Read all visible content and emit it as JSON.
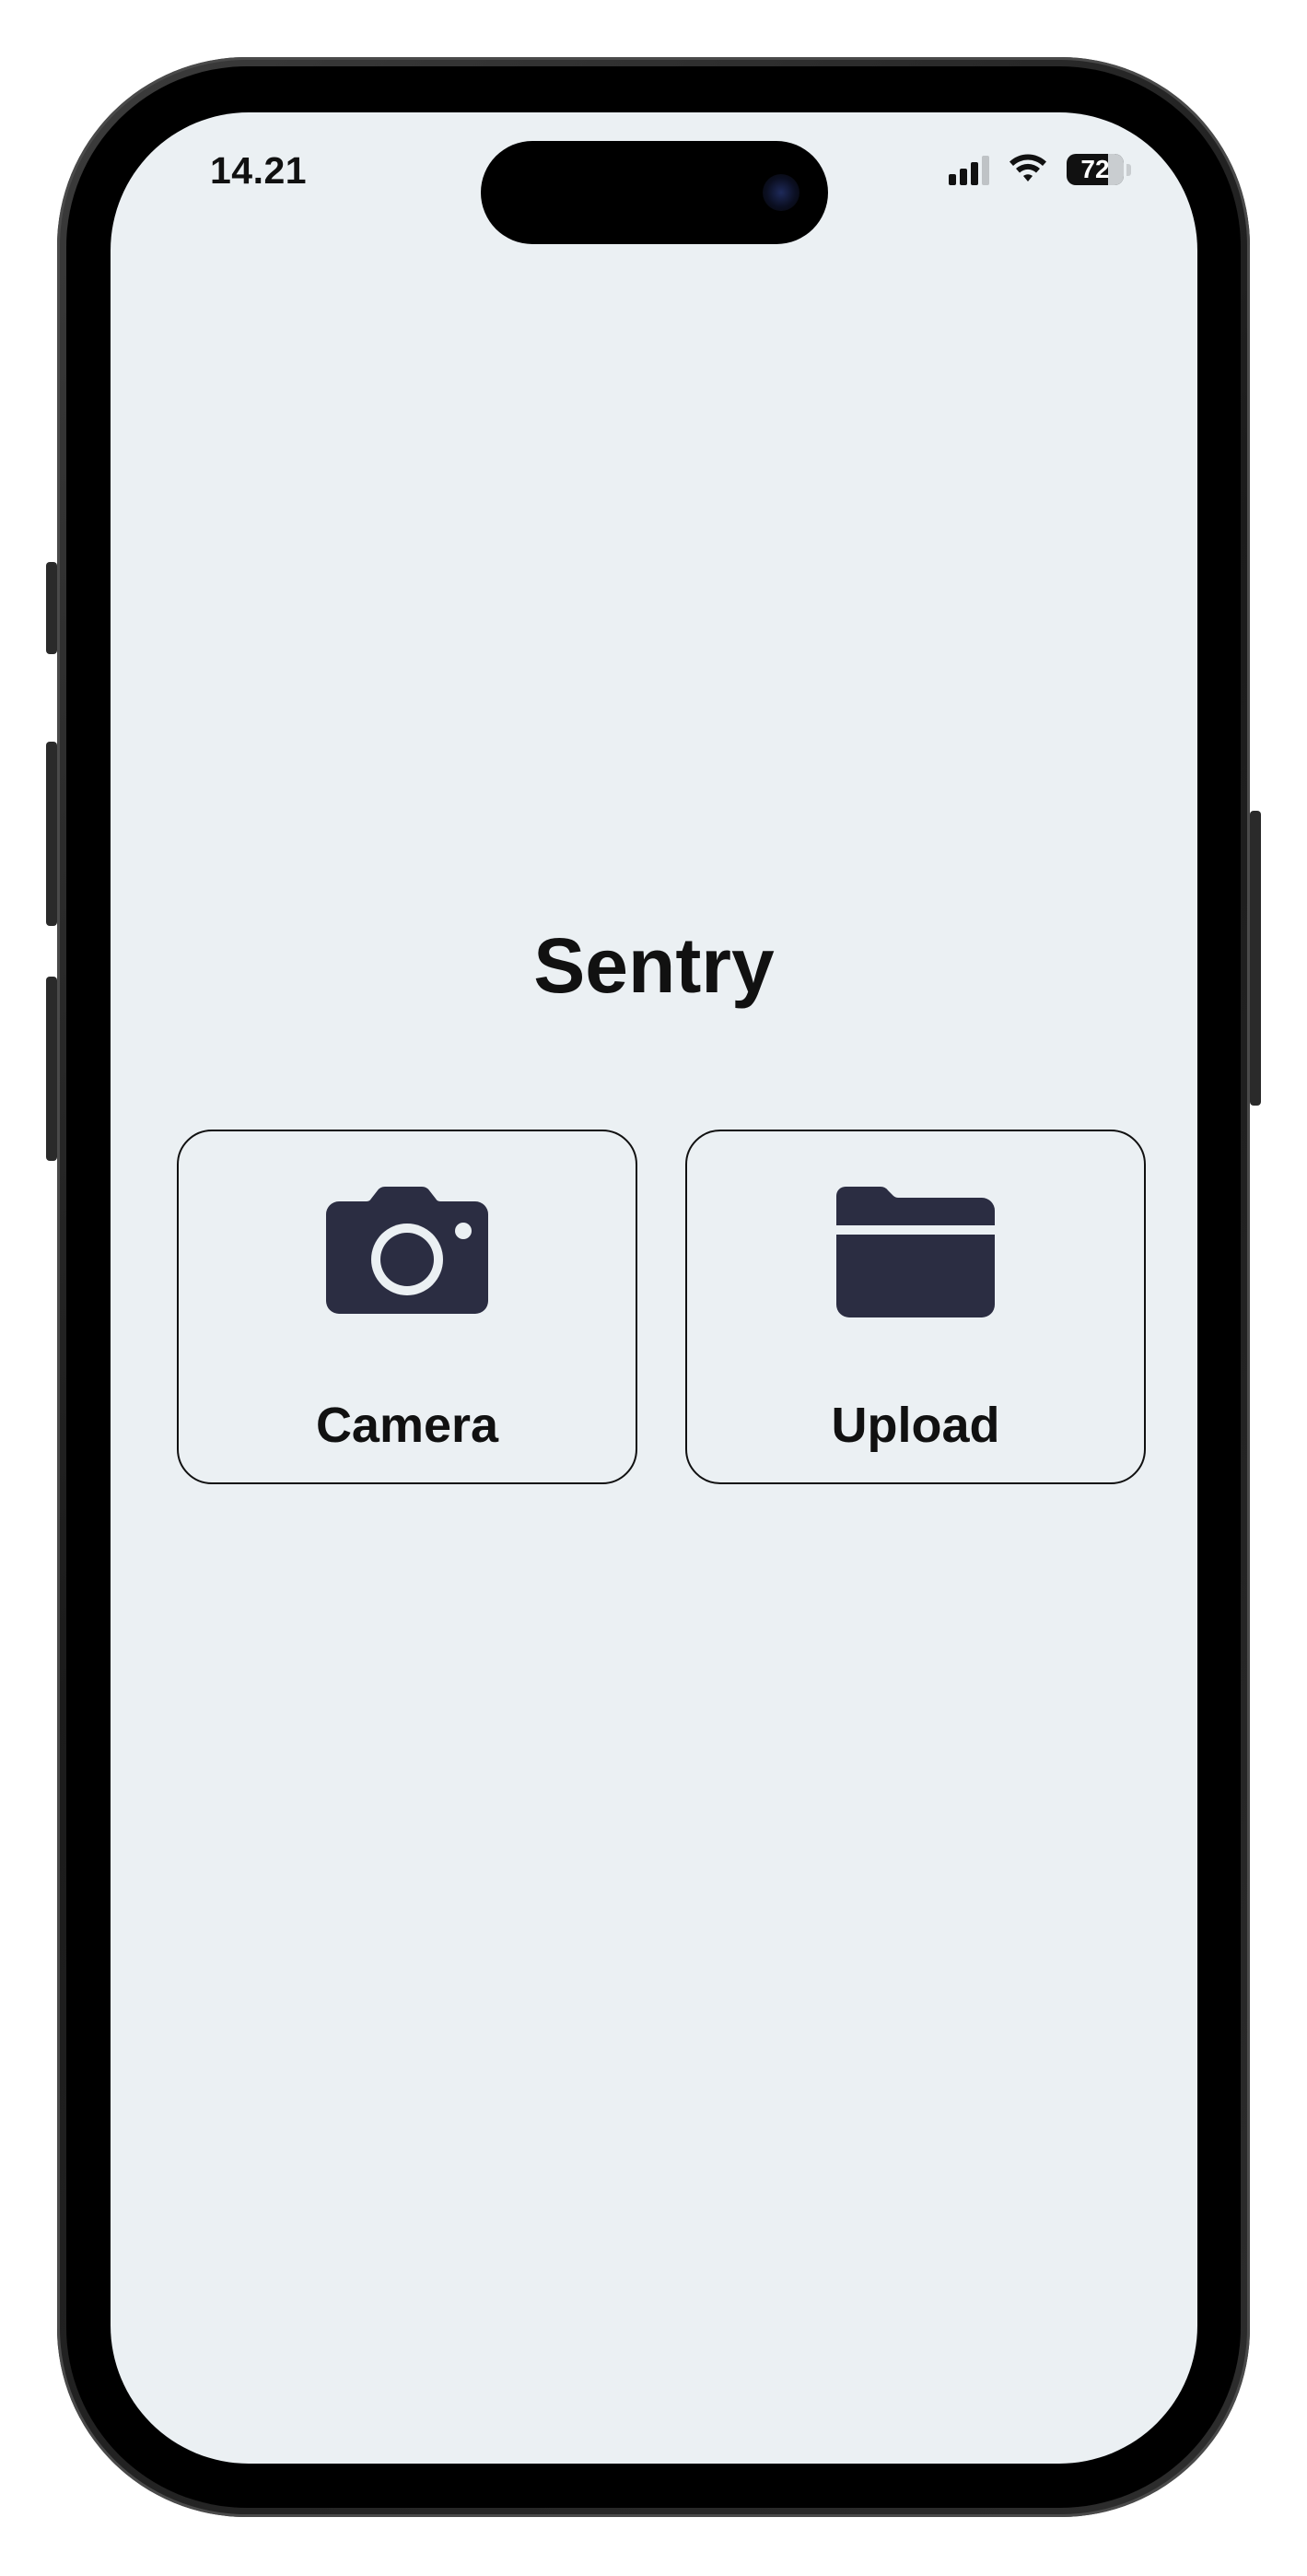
{
  "status_bar": {
    "time": "14.21",
    "battery_percent": "72",
    "battery_level": 0.72,
    "signal_bars_active": 3,
    "signal_bars_total": 4,
    "wifi_icon": "wifi-icon"
  },
  "app": {
    "title": "Sentry"
  },
  "actions": [
    {
      "label": "Camera",
      "icon": "camera-icon"
    },
    {
      "label": "Upload",
      "icon": "folder-icon"
    }
  ],
  "colors": {
    "background": "#ebf0f3",
    "icon_fill": "#2b2d42",
    "text": "#111111"
  }
}
